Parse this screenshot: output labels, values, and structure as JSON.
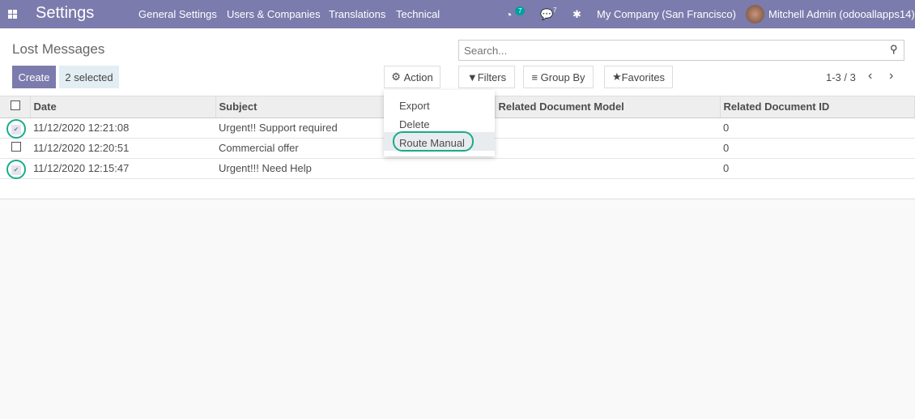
{
  "navbar": {
    "app": "Settings",
    "menu": [
      "General Settings",
      "Users & Companies",
      "Translations",
      "Technical"
    ],
    "activity_count": "7",
    "message_count": "7",
    "company": "My Company (San Francisco)",
    "user": "Mitchell Admin (odooallapps14)"
  },
  "control": {
    "title": "Lost Messages",
    "create": "Create",
    "selected": "2 selected",
    "action": "Action",
    "search_placeholder": "Search...",
    "filters": "Filters",
    "group_by": "Group By",
    "favorites": "Favorites",
    "pager": "1-3 / 3"
  },
  "action_menu": [
    "Export",
    "Delete",
    "Route Manual"
  ],
  "table": {
    "headers": [
      "Date",
      "Subject",
      "Related Document Model",
      "Related Document ID"
    ],
    "rows": [
      {
        "date": "11/12/2020 12:21:08",
        "subject": "Urgent!! Support required",
        "model": "",
        "id": "0",
        "checked": true
      },
      {
        "date": "11/12/2020 12:20:51",
        "subject": "Commercial offer",
        "model": "",
        "id": "0",
        "checked": false
      },
      {
        "date": "11/12/2020 12:15:47",
        "subject": "Urgent!!! Need Help",
        "model": "",
        "id": "0",
        "checked": true
      }
    ]
  }
}
